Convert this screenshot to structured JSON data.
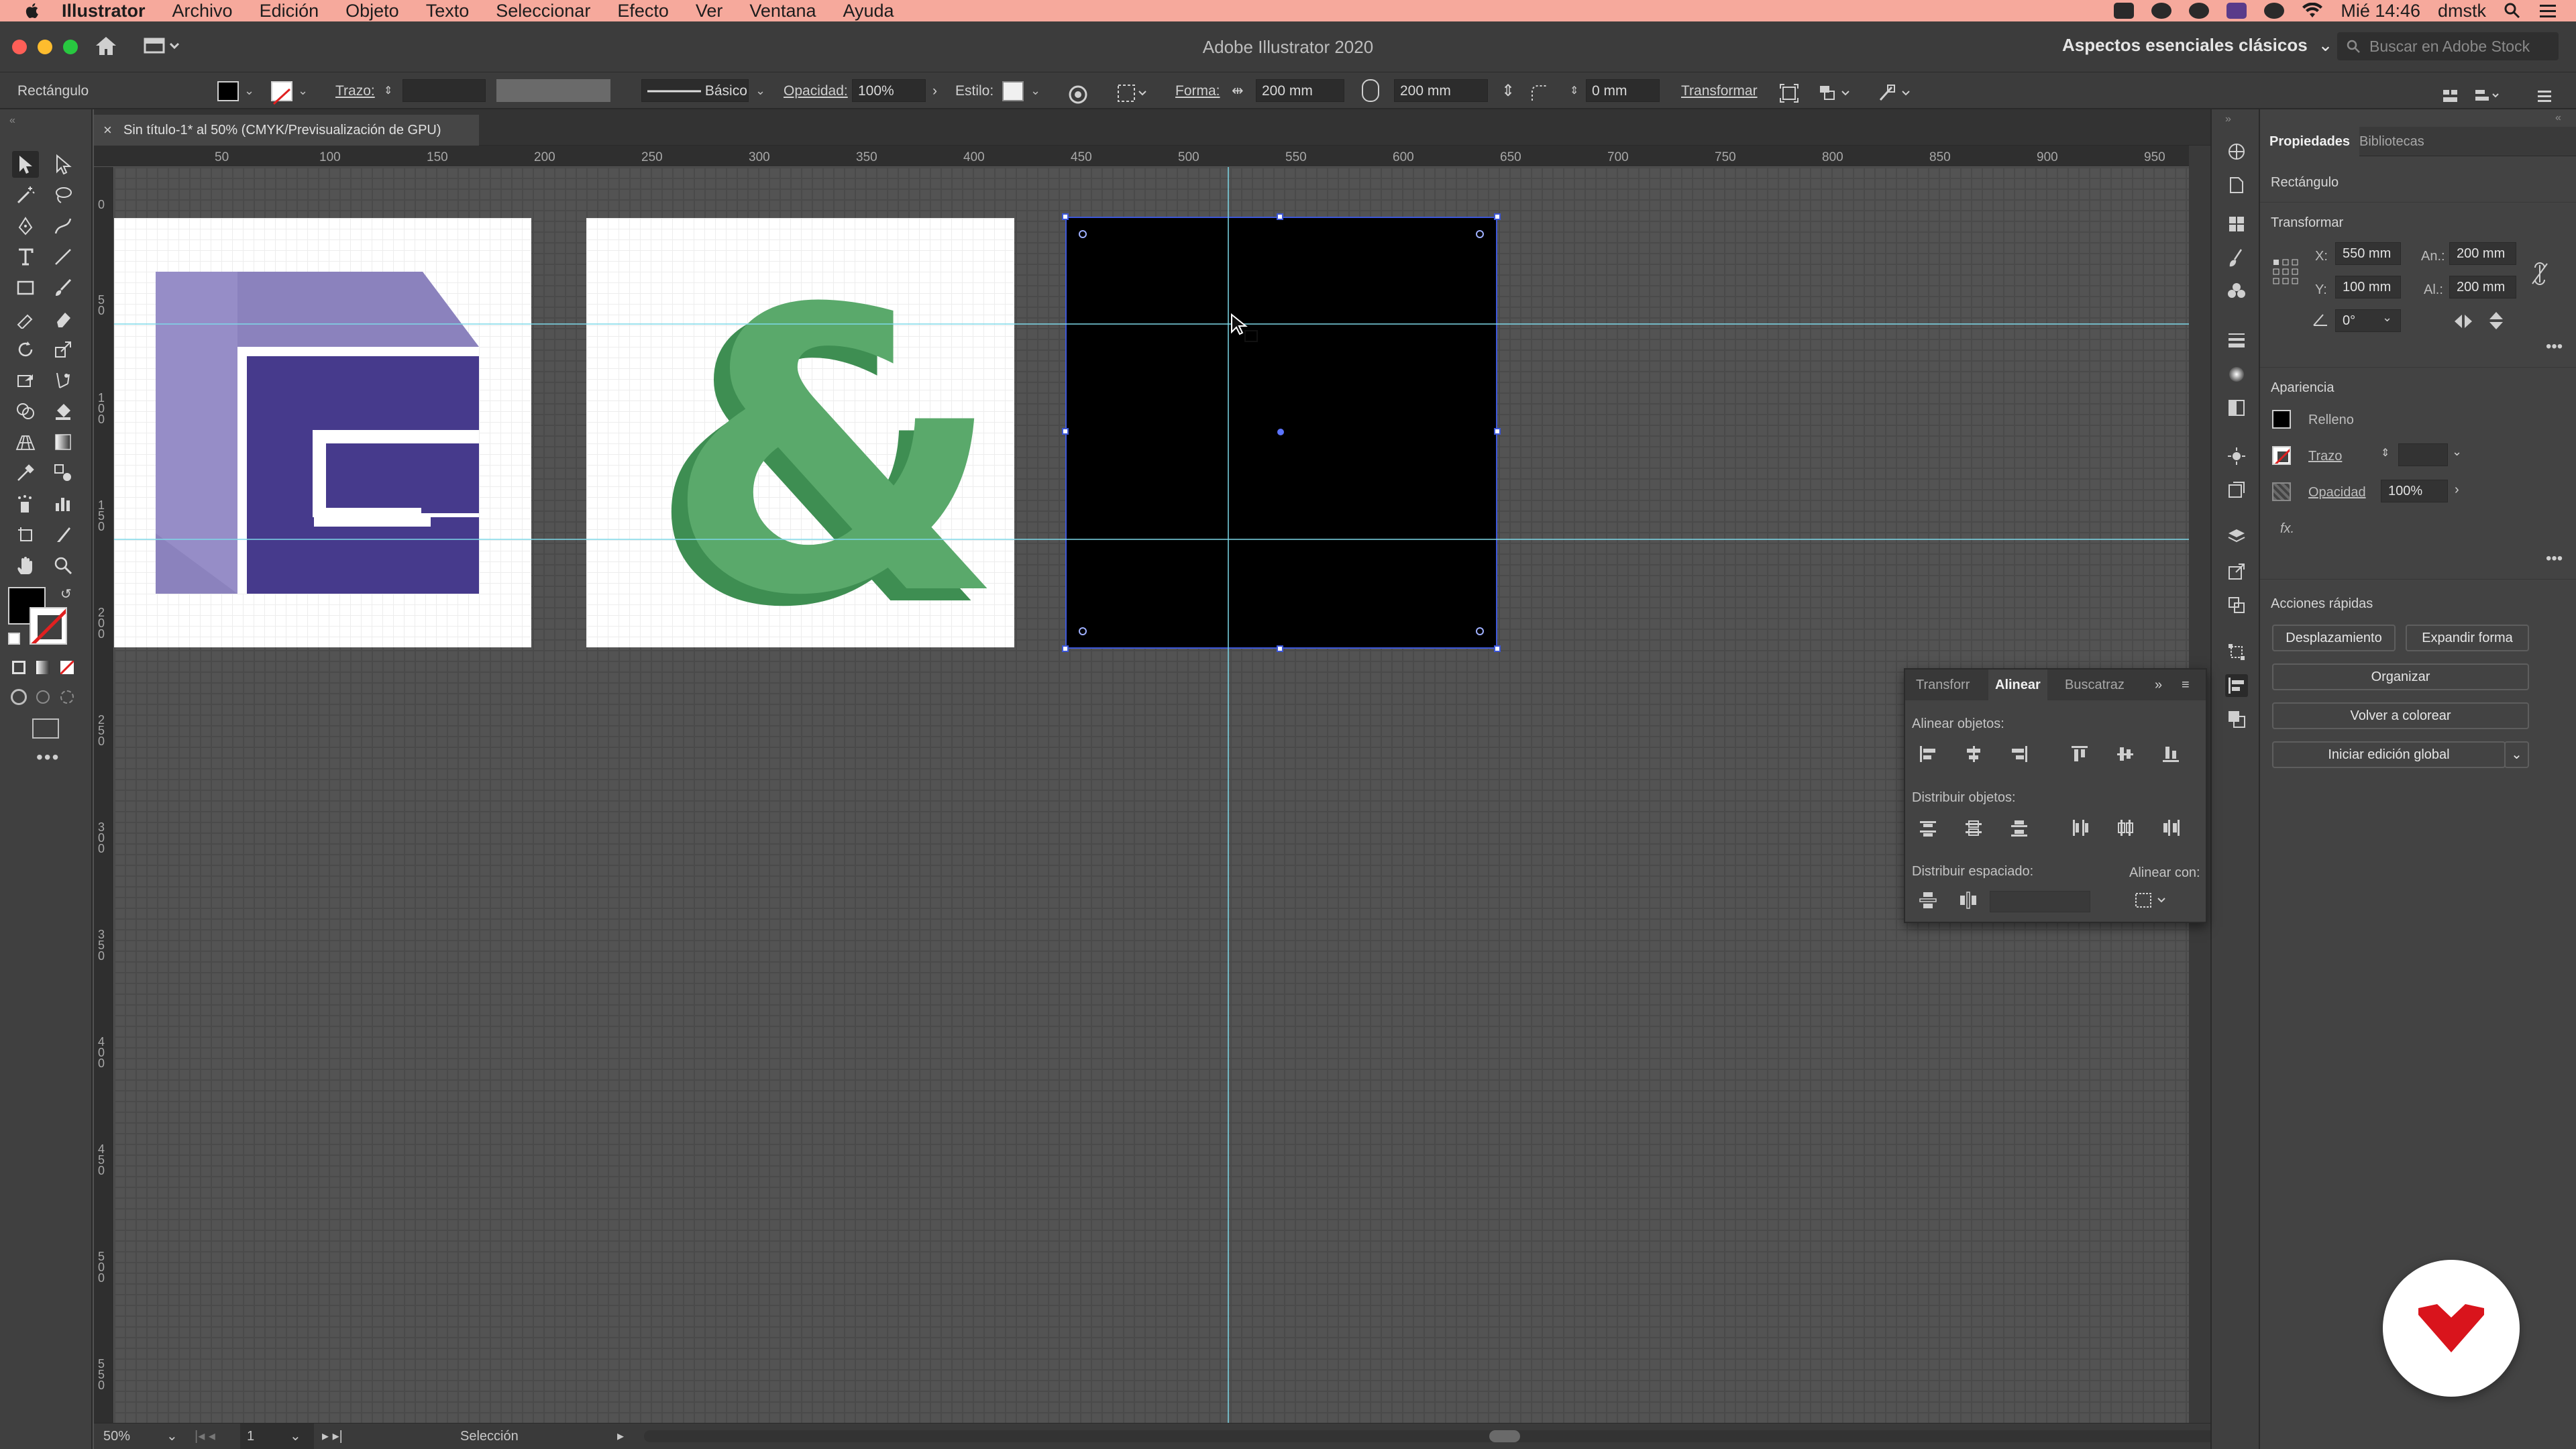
{
  "menubar": {
    "app_name": "Illustrator",
    "items": [
      "Archivo",
      "Edición",
      "Objeto",
      "Texto",
      "Seleccionar",
      "Efecto",
      "Ver",
      "Ventana",
      "Ayuda"
    ],
    "clock": "Mié 14:46",
    "user": "dmstk"
  },
  "titlebar": {
    "title": "Adobe Illustrator 2020",
    "workspace": "Aspectos esenciales clásicos",
    "search_placeholder": "Buscar en Adobe Stock"
  },
  "controlbar": {
    "selection_type": "Rectángulo",
    "stroke_label": "Trazo:",
    "brush_label": "Básico",
    "opacity_label": "Opacidad:",
    "opacity_value": "100%",
    "style_label": "Estilo:",
    "shape_label": "Forma:",
    "width_value": "200 mm",
    "height_value": "200 mm",
    "corner_value": "0 mm",
    "transform_label": "Transformar"
  },
  "document": {
    "tab_title": "Sin título-1* al 50% (CMYK/Previsualización de GPU)"
  },
  "rulers": {
    "horizontal": [
      "50",
      "100",
      "150",
      "200",
      "250",
      "300",
      "350",
      "400",
      "450",
      "500",
      "550",
      "600",
      "650",
      "700",
      "750",
      "800",
      "850",
      "900",
      "950"
    ],
    "vertical": [
      "0",
      "50",
      "100",
      "150",
      "200",
      "250",
      "300",
      "350",
      "400",
      "450",
      "500",
      "550"
    ]
  },
  "statusbar": {
    "zoom": "50%",
    "artboard_number": "1",
    "tool_status": "Selección"
  },
  "properties": {
    "tab_active": "Propiedades",
    "tab_inactive": "Bibliotecas",
    "object_type": "Rectángulo",
    "transform_title": "Transformar",
    "x_label": "X:",
    "x_value": "550 mm",
    "y_label": "Y:",
    "y_value": "100 mm",
    "w_label": "An.:",
    "w_value": "200 mm",
    "h_label": "Al.:",
    "h_value": "200 mm",
    "angle_value": "0°",
    "appearance_title": "Apariencia",
    "fill_label": "Relleno",
    "stroke_label": "Trazo",
    "opacity_label": "Opacidad",
    "opacity_value": "100%",
    "fx_label": "fx.",
    "quick_actions_title": "Acciones rápidas",
    "btn_offset": "Desplazamiento",
    "btn_expand": "Expandir forma",
    "btn_arrange": "Organizar",
    "btn_recolor": "Volver a colorear",
    "btn_global_edit": "Iniciar edición global"
  },
  "align_panel": {
    "tab_transform": "Transforr",
    "tab_align": "Alinear",
    "tab_pathfinder": "Buscatraz",
    "align_objects": "Alinear objetos:",
    "distribute_objects": "Distribuir objetos:",
    "distribute_spacing": "Distribuir espaciado:",
    "align_to": "Alinear con:"
  },
  "colors": {
    "menubar_bg": "#f6a99c",
    "logo_light_purple": "#8b82bd",
    "logo_dark_purple": "#463a8c",
    "ampersand_green": "#5aa96b",
    "ampersand_dark_green": "#3e8e52",
    "selection_blue": "#3d57d8",
    "guide_cyan": "#7ed8e8",
    "badge_red": "#d9141c"
  }
}
